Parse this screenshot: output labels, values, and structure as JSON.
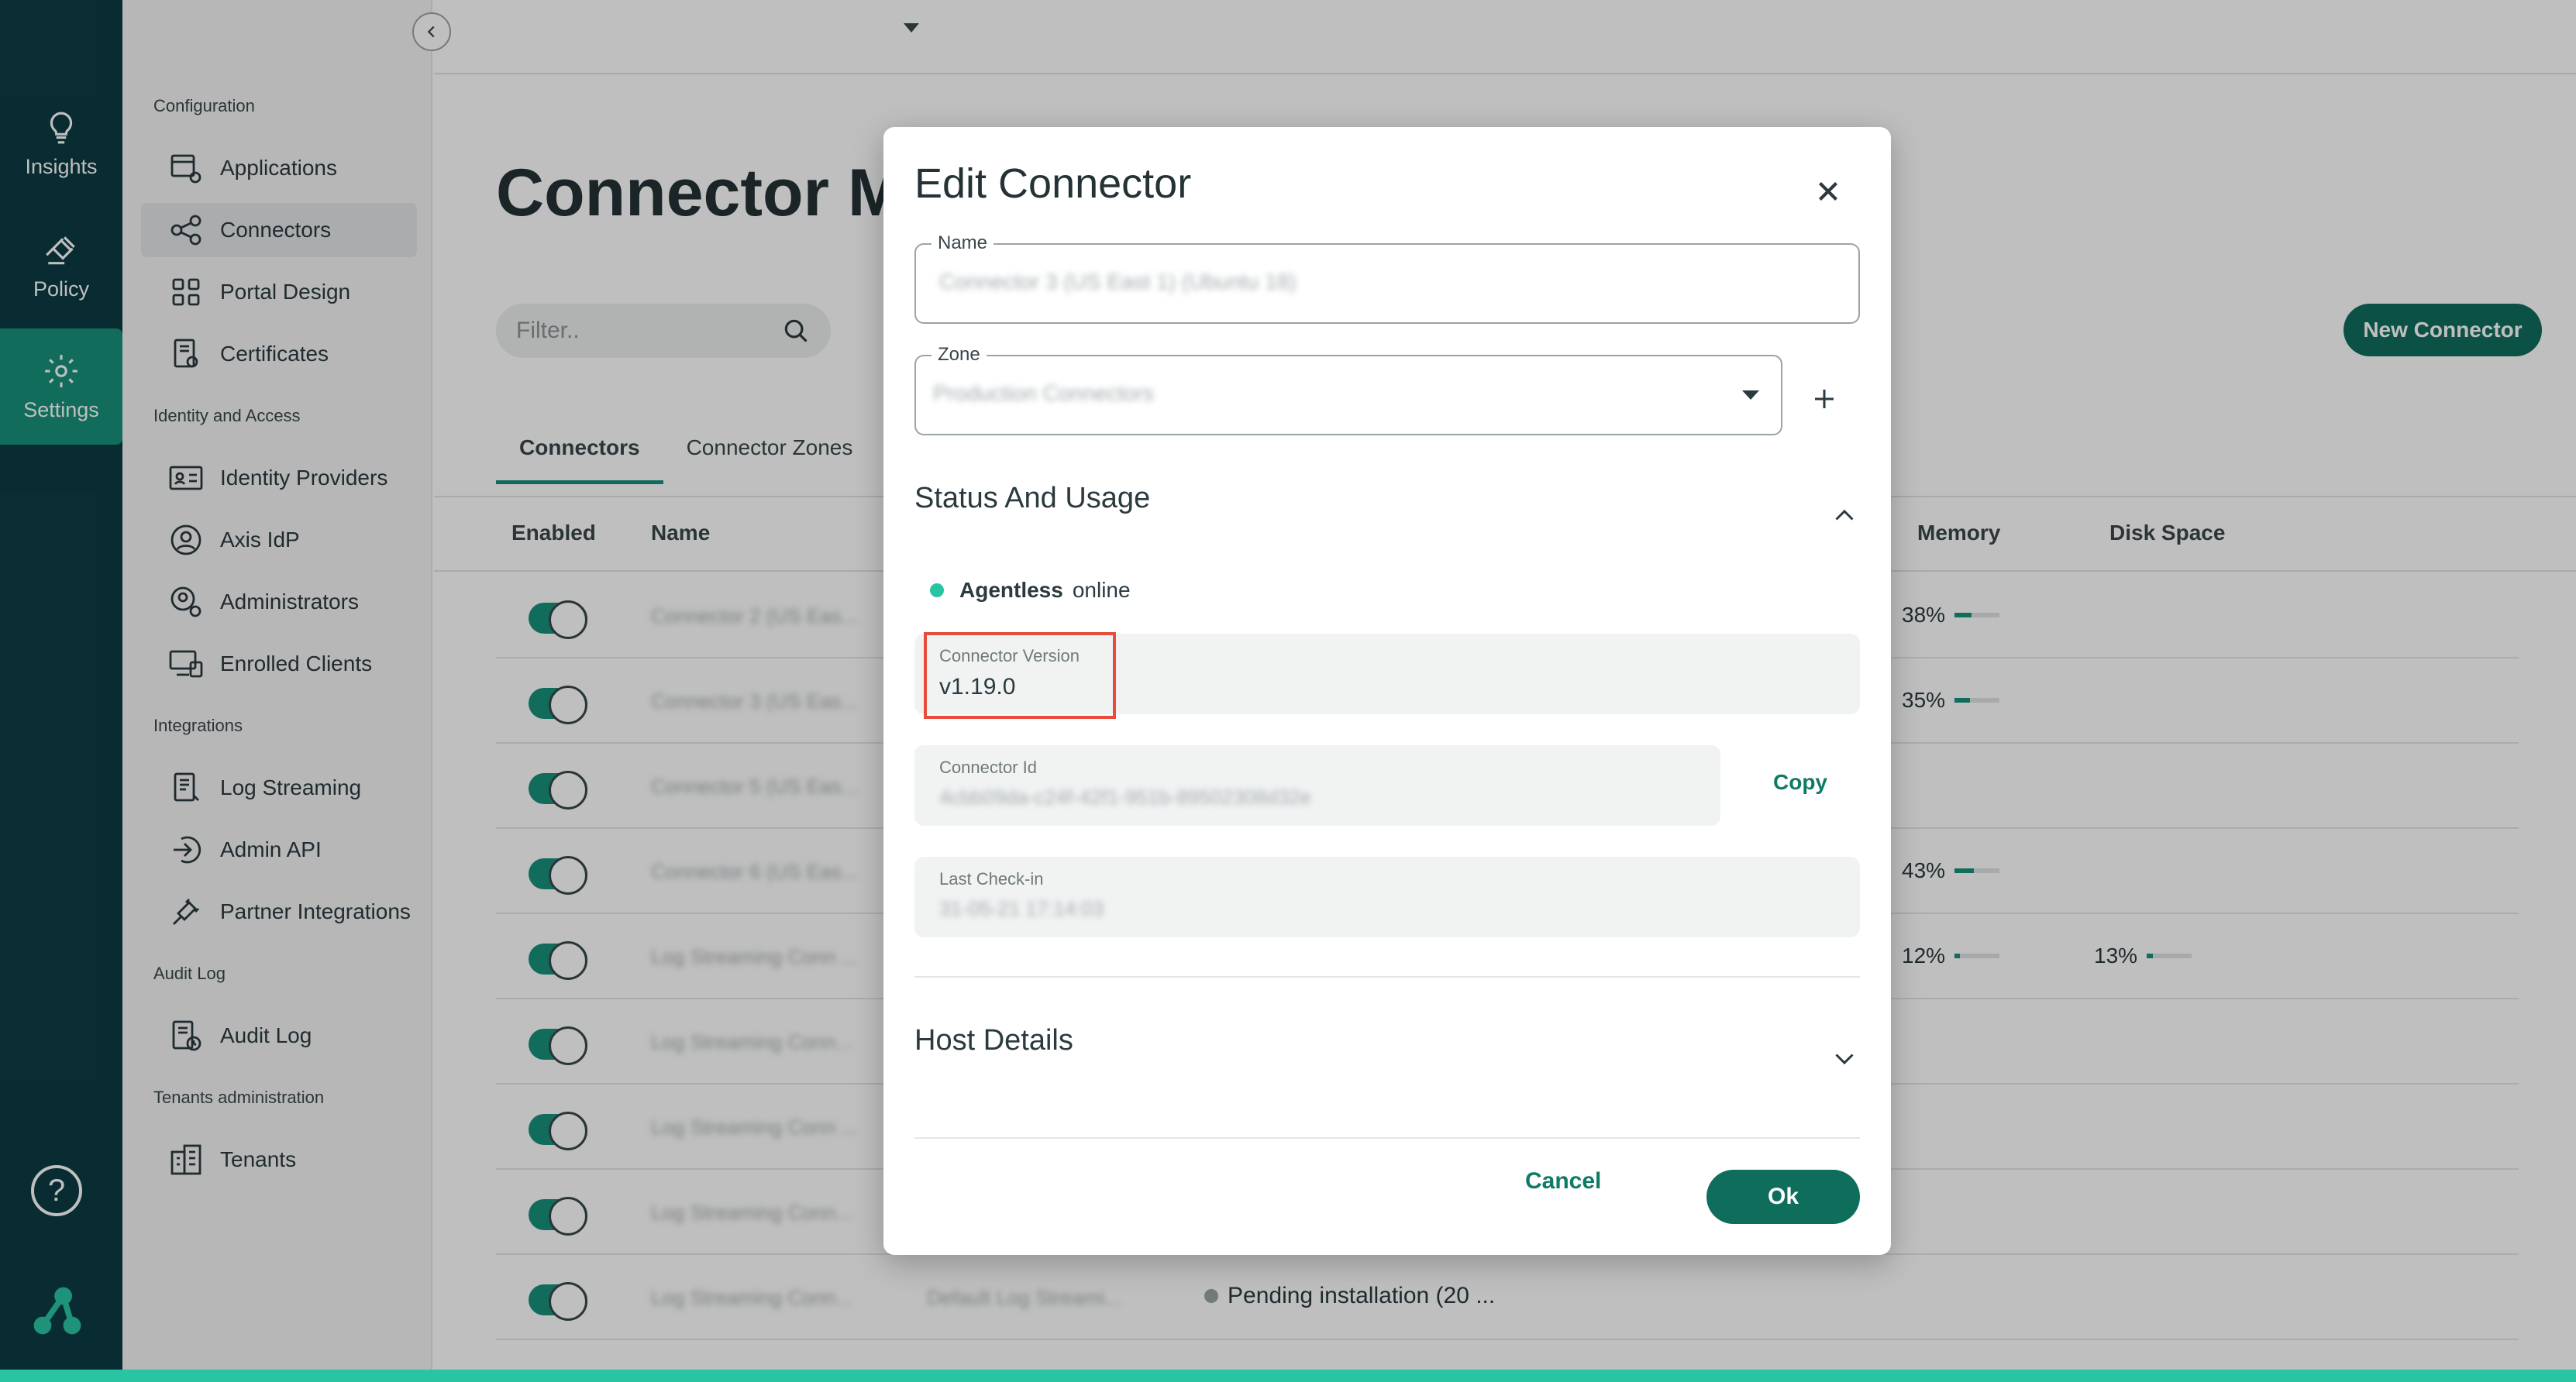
{
  "rail": {
    "items": [
      {
        "label": "Insights",
        "icon": "lightbulb-icon"
      },
      {
        "label": "Policy",
        "icon": "gavel-icon"
      },
      {
        "label": "Settings",
        "icon": "gear-icon"
      }
    ],
    "help_symbol": "?"
  },
  "sidebar": {
    "groups": [
      {
        "title": "Configuration"
      },
      {
        "title": "Identity and Access"
      },
      {
        "title": "Integrations"
      },
      {
        "title": "Audit Log"
      },
      {
        "title": "Tenants administration"
      }
    ],
    "items": [
      {
        "label": "Applications"
      },
      {
        "label": "Connectors"
      },
      {
        "label": "Portal Design"
      },
      {
        "label": "Certificates"
      },
      {
        "label": "Identity Providers"
      },
      {
        "label": "Axis IdP"
      },
      {
        "label": "Administrators"
      },
      {
        "label": "Enrolled Clients"
      },
      {
        "label": "Log Streaming"
      },
      {
        "label": "Admin API"
      },
      {
        "label": "Partner Integrations"
      },
      {
        "label": "Audit Log"
      },
      {
        "label": "Tenants"
      }
    ]
  },
  "main": {
    "title": "Connector Ma",
    "filter_placeholder": "Filter..",
    "tabs": [
      {
        "label": "Connectors"
      },
      {
        "label": "Connector Zones"
      }
    ],
    "new_button": "New Connector",
    "columns": {
      "enabled": "Enabled",
      "name": "Name",
      "memory": "Memory",
      "disk": "Disk Space"
    },
    "rows": [
      {
        "name": "Connector 2 (US Eas...",
        "memory": "38%",
        "memory_fill": 0.38,
        "disk": "",
        "disk_fill": 0
      },
      {
        "name": "Connector 3 (US Eas...",
        "memory": "35%",
        "memory_fill": 0.35,
        "disk": "",
        "disk_fill": 0
      },
      {
        "name": "Connector 5 (US Eas...",
        "memory": "",
        "memory_fill": 0,
        "disk": "",
        "disk_fill": 0
      },
      {
        "name": "Connector 6 (US Eas...",
        "memory": "43%",
        "memory_fill": 0.43,
        "disk": "",
        "disk_fill": 0
      },
      {
        "name": "Log Streaming Conn ...",
        "memory": "12%",
        "memory_fill": 0.12,
        "disk": "13%",
        "disk_fill": 0.13
      },
      {
        "name": "Log Streaming Conn...",
        "memory": "",
        "memory_fill": 0,
        "disk": "",
        "disk_fill": 0
      },
      {
        "name": "Log Streaming Conn ...",
        "memory": "",
        "memory_fill": 0,
        "disk": "",
        "disk_fill": 0
      },
      {
        "name": "Log Streaming Conn...",
        "memory": "",
        "memory_fill": 0,
        "disk": "",
        "disk_fill": 0
      },
      {
        "name": "Log Streaming Conn...",
        "zone": "Default Log Streami...",
        "status": "Pending installation (20 ..."
      }
    ]
  },
  "modal": {
    "title": "Edit Connector",
    "name_label": "Name",
    "name_value": "Connector 3 (US East 1) (Ubuntu 18)",
    "zone_label": "Zone",
    "zone_value": "Production Connectors",
    "status_section": "Status And Usage",
    "status_type": "Agentless",
    "status_state": "online",
    "version_label": "Connector Version",
    "version_value": "v1.19.0",
    "id_label": "Connector Id",
    "id_value": "4cbb09da-c24f-42f1-951b-89502308d32e",
    "copy_label": "Copy",
    "checkin_label": "Last Check-in",
    "checkin_value": "31-05-21 17:14:03",
    "host_section": "Host Details",
    "cancel_label": "Cancel",
    "ok_label": "Ok"
  },
  "colors": {
    "rail": "#0d3b44",
    "accent": "#17917b",
    "primary_button": "#0f6d5c",
    "highlight": "#e74c3c"
  }
}
